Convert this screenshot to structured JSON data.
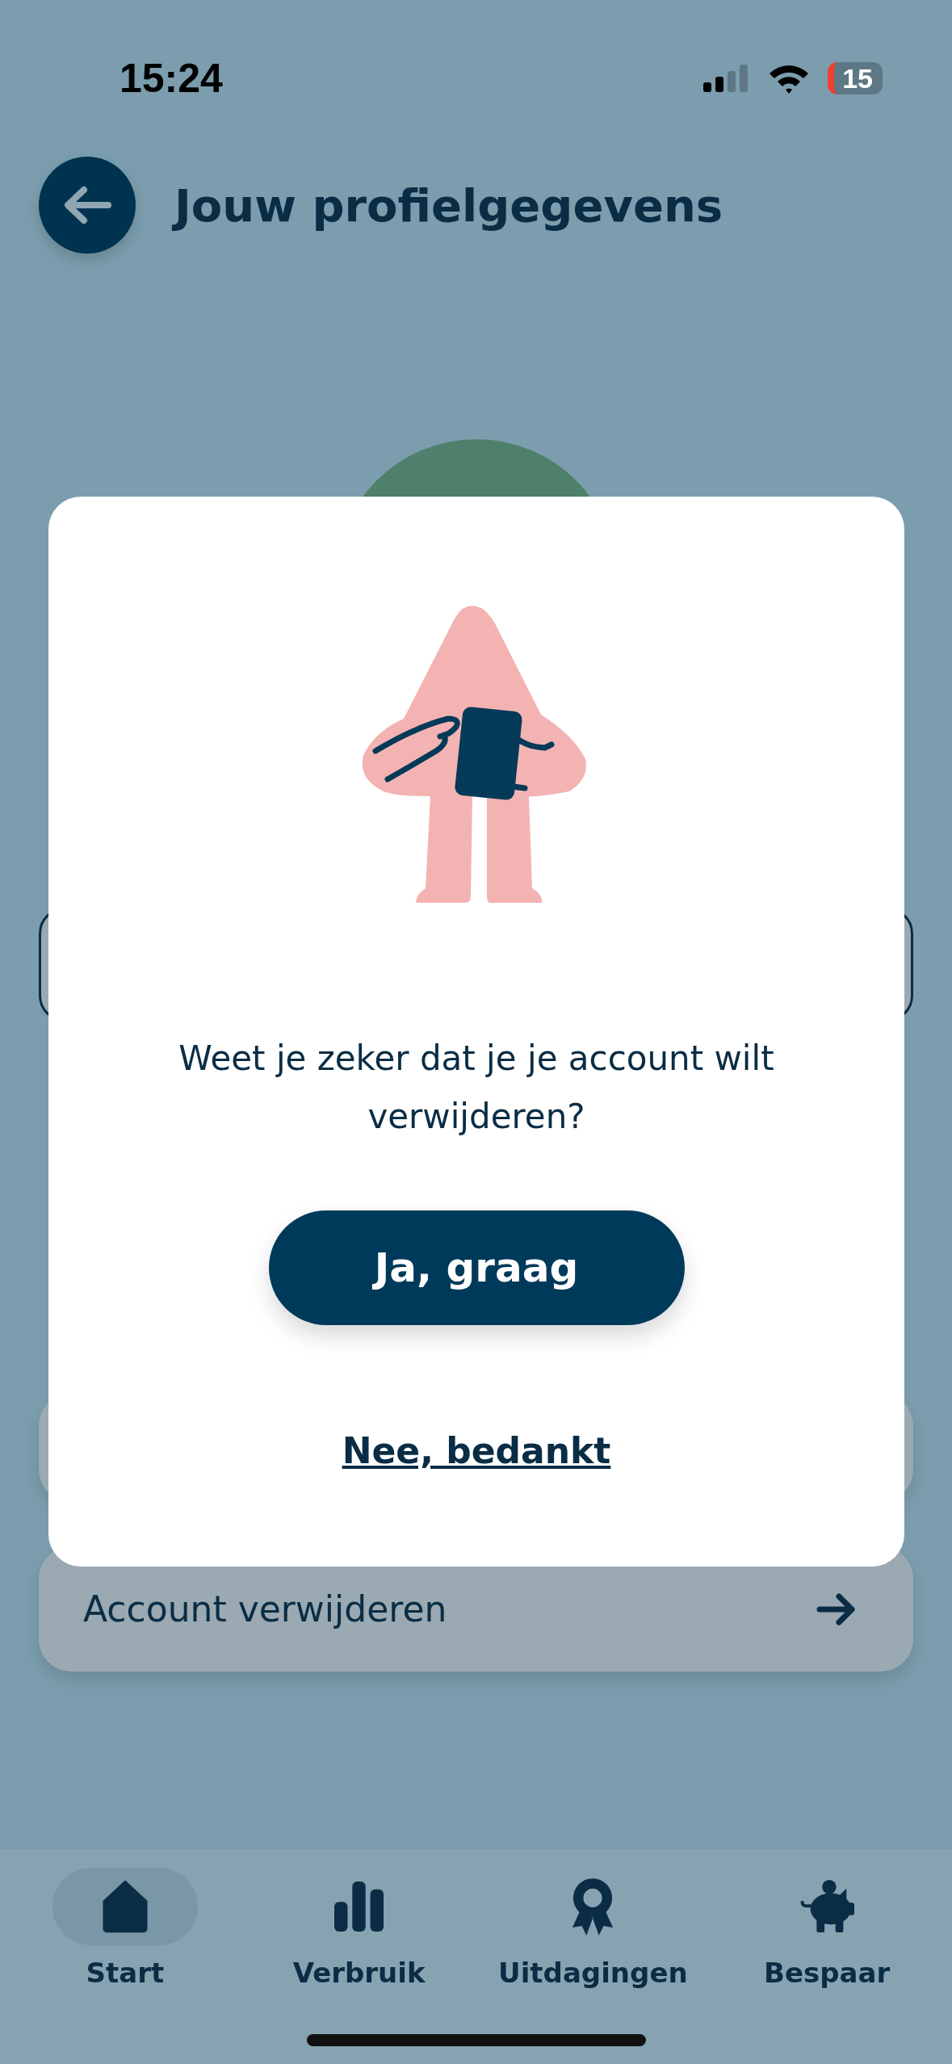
{
  "status_bar": {
    "time": "15:24",
    "battery": "15"
  },
  "header": {
    "title": "Jouw profielgegevens"
  },
  "background_items": [
    {
      "label": "Account verwijderen"
    }
  ],
  "dialog": {
    "message": "Weet je zeker dat je je account wilt verwijderen?",
    "confirm": "Ja, graag",
    "cancel": "Nee, bedankt"
  },
  "tab_bar": [
    {
      "label": "Start",
      "kind": "home",
      "selected": true
    },
    {
      "label": "Verbruik",
      "kind": "chart",
      "selected": false
    },
    {
      "label": "Uitdagingen",
      "kind": "award",
      "selected": false
    },
    {
      "label": "Bespaar",
      "kind": "piggy",
      "selected": false
    }
  ]
}
